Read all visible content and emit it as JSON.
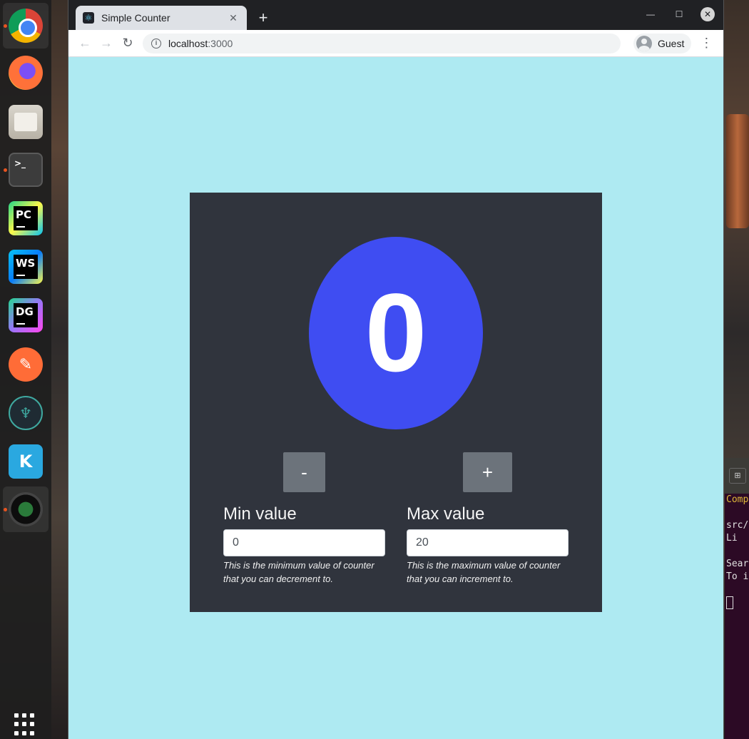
{
  "browser": {
    "tab_title": "Simple Counter",
    "tab_close": "✕",
    "new_tab": "+",
    "url_host": "localhost",
    "url_port": ":3000",
    "profile_name": "Guest"
  },
  "counter": {
    "value": "0",
    "decrement_label": "-",
    "increment_label": "+",
    "circle_color": "#3f4df2",
    "card_color": "#30343d",
    "page_background": "#aeeaf2"
  },
  "min_field": {
    "label": "Min value",
    "value": "0",
    "help": "This is the minimum value of counter that you can decrement to."
  },
  "max_field": {
    "label": "Max value",
    "value": "20",
    "help": "This is the maximum value of counter that you can increment to."
  },
  "terminal": {
    "lines": [
      "Comp",
      "",
      "src/",
      "  Li",
      "",
      "Sear",
      "To i"
    ]
  },
  "dock": {
    "apps": [
      "chrome-icon",
      "firefox-icon",
      "files-icon",
      "terminal-icon",
      "pycharm-icon",
      "webstorm-icon",
      "datagrip-icon",
      "postman-icon",
      "gitkraken-icon",
      "kite-icon",
      "webcam-icon"
    ],
    "pc_label": "PC",
    "ws_label": "WS",
    "dg_label": "DG",
    "terminal_prompt": ">_"
  }
}
